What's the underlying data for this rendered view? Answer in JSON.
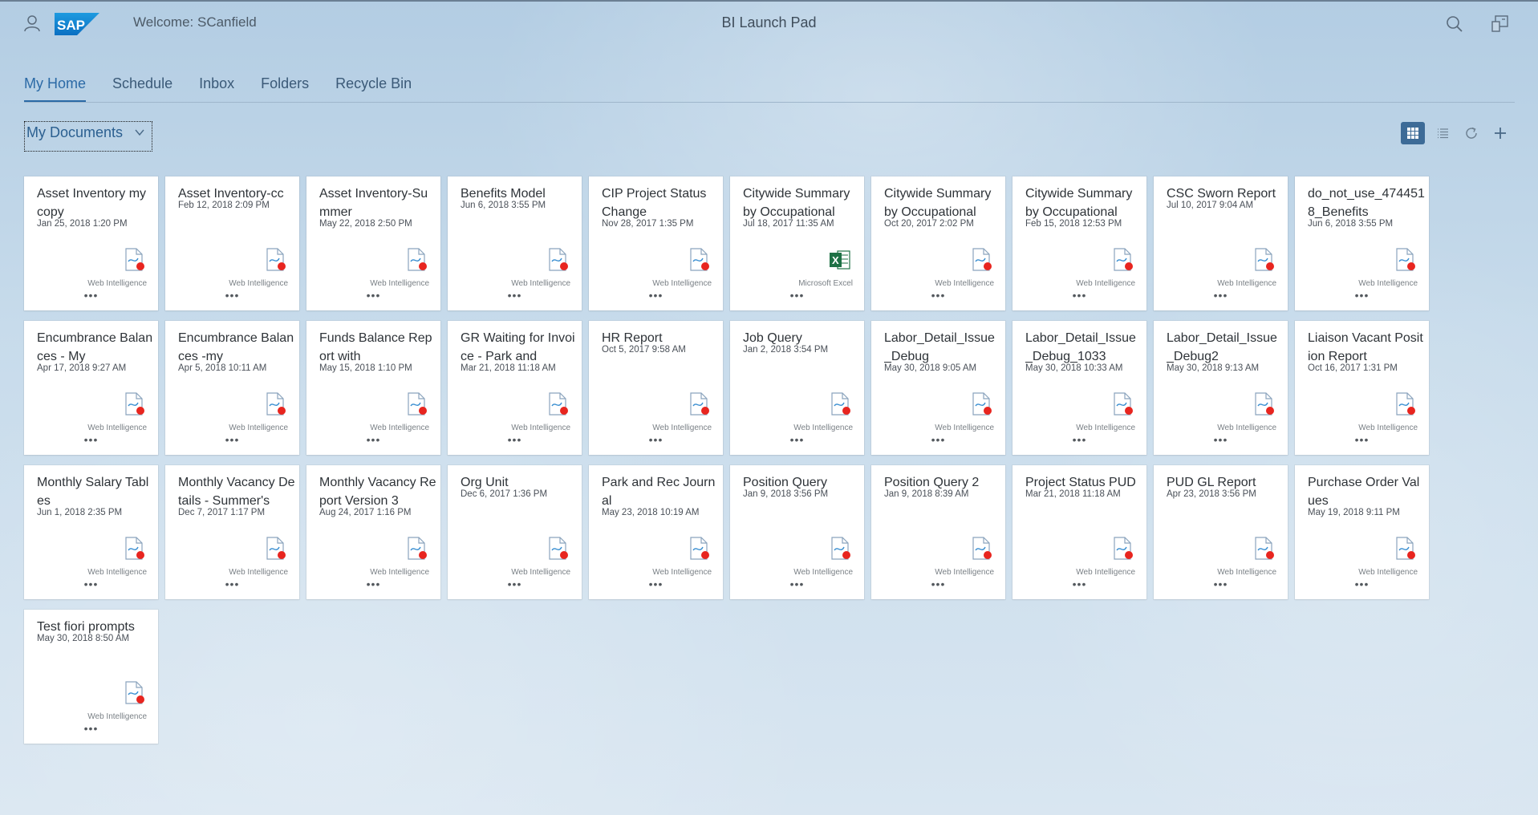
{
  "shell": {
    "welcome": "Welcome: SCanfield",
    "title": "BI Launch Pad",
    "logo_text": "SAP",
    "icons": [
      "user-icon",
      "search-icon",
      "notifications-icon"
    ]
  },
  "tabs": [
    {
      "label": "My Home",
      "active": true
    },
    {
      "label": "Schedule",
      "active": false
    },
    {
      "label": "Inbox",
      "active": false
    },
    {
      "label": "Folders",
      "active": false
    },
    {
      "label": "Recycle Bin",
      "active": false
    }
  ],
  "selector": {
    "label": "My Documents"
  },
  "toolbar_icons": [
    "tile-view-icon",
    "list-view-icon",
    "refresh-icon",
    "add-icon"
  ],
  "colors": {
    "accent": "#2b6aa6",
    "toolbar_active": "#3d6b97",
    "webi_dot": "#e8251f",
    "excel": "#1e7145"
  },
  "documents": [
    {
      "title": "Asset Inventory my copy",
      "date": "Jan 25, 2018 1:20 PM",
      "type": "Web Intelligence",
      "kind": "webi"
    },
    {
      "title": "Asset Inventory-cc",
      "date": "Feb 12, 2018 2:09 PM",
      "type": "Web Intelligence",
      "kind": "webi"
    },
    {
      "title": "Asset Inventory-Summer",
      "date": "May 22, 2018 2:50 PM",
      "type": "Web Intelligence",
      "kind": "webi"
    },
    {
      "title": "Benefits Model",
      "date": "Jun 6, 2018 3:55 PM",
      "type": "Web Intelligence",
      "kind": "webi"
    },
    {
      "title": "CIP Project Status Change",
      "date": "Nov 28, 2017 1:35 PM",
      "type": "Web Intelligence",
      "kind": "webi"
    },
    {
      "title": "Citywide Summary by Occupational",
      "date": "Jul 18, 2017 11:35 AM",
      "type": "Microsoft Excel",
      "kind": "excel"
    },
    {
      "title": "Citywide Summary by Occupational",
      "date": "Oct 20, 2017 2:02 PM",
      "type": "Web Intelligence",
      "kind": "webi"
    },
    {
      "title": "Citywide Summary by Occupational",
      "date": "Feb 15, 2018 12:53 PM",
      "type": "Web Intelligence",
      "kind": "webi"
    },
    {
      "title": "CSC Sworn Report",
      "date": "Jul 10, 2017 9:04 AM",
      "type": "Web Intelligence",
      "kind": "webi"
    },
    {
      "title": "do_not_use_4744518_Benefits",
      "date": "Jun 6, 2018 3:55 PM",
      "type": "Web Intelligence",
      "kind": "webi"
    },
    {
      "title": "Encumbrance Balances - My",
      "date": "Apr 17, 2018 9:27 AM",
      "type": "Web Intelligence",
      "kind": "webi"
    },
    {
      "title": "Encumbrance Balances -my",
      "date": "Apr 5, 2018 10:11 AM",
      "type": "Web Intelligence",
      "kind": "webi"
    },
    {
      "title": "Funds Balance Report with",
      "date": "May 15, 2018 1:10 PM",
      "type": "Web Intelligence",
      "kind": "webi"
    },
    {
      "title": "GR Waiting for Invoice - Park and",
      "date": "Mar 21, 2018 11:18 AM",
      "type": "Web Intelligence",
      "kind": "webi"
    },
    {
      "title": "HR Report",
      "date": "Oct 5, 2017 9:58 AM",
      "type": "Web Intelligence",
      "kind": "webi"
    },
    {
      "title": "Job Query",
      "date": "Jan 2, 2018 3:54 PM",
      "type": "Web Intelligence",
      "kind": "webi"
    },
    {
      "title": "Labor_Detail_Issue_Debug",
      "date": "May 30, 2018 9:05 AM",
      "type": "Web Intelligence",
      "kind": "webi"
    },
    {
      "title": "Labor_Detail_Issue_Debug_1033",
      "date": "May 30, 2018 10:33 AM",
      "type": "Web Intelligence",
      "kind": "webi"
    },
    {
      "title": "Labor_Detail_Issue_Debug2",
      "date": "May 30, 2018 9:13 AM",
      "type": "Web Intelligence",
      "kind": "webi"
    },
    {
      "title": "Liaison Vacant Position Report",
      "date": "Oct 16, 2017 1:31 PM",
      "type": "Web Intelligence",
      "kind": "webi"
    },
    {
      "title": "Monthly Salary Tables",
      "date": "Jun 1, 2018 2:35 PM",
      "type": "Web Intelligence",
      "kind": "webi"
    },
    {
      "title": "Monthly Vacancy Details - Summer's",
      "date": "Dec 7, 2017 1:17 PM",
      "type": "Web Intelligence",
      "kind": "webi"
    },
    {
      "title": "Monthly Vacancy Report Version 3",
      "date": "Aug 24, 2017 1:16 PM",
      "type": "Web Intelligence",
      "kind": "webi"
    },
    {
      "title": "Org Unit",
      "date": "Dec 6, 2017 1:36 PM",
      "type": "Web Intelligence",
      "kind": "webi"
    },
    {
      "title": "Park and Rec Journal",
      "date": "May 23, 2018 10:19 AM",
      "type": "Web Intelligence",
      "kind": "webi"
    },
    {
      "title": "Position Query",
      "date": "Jan 9, 2018 3:56 PM",
      "type": "Web Intelligence",
      "kind": "webi"
    },
    {
      "title": "Position Query 2",
      "date": "Jan 9, 2018 8:39 AM",
      "type": "Web Intelligence",
      "kind": "webi"
    },
    {
      "title": "Project Status PUD",
      "date": "Mar 21, 2018 11:18 AM",
      "type": "Web Intelligence",
      "kind": "webi"
    },
    {
      "title": "PUD GL Report",
      "date": "Apr 23, 2018 3:56 PM",
      "type": "Web Intelligence",
      "kind": "webi"
    },
    {
      "title": "Purchase Order Values",
      "date": "May 19, 2018 9:11 PM",
      "type": "Web Intelligence",
      "kind": "webi"
    },
    {
      "title": "Test fiori prompts",
      "date": "May 30, 2018 8:50 AM",
      "type": "Web Intelligence",
      "kind": "webi"
    }
  ]
}
